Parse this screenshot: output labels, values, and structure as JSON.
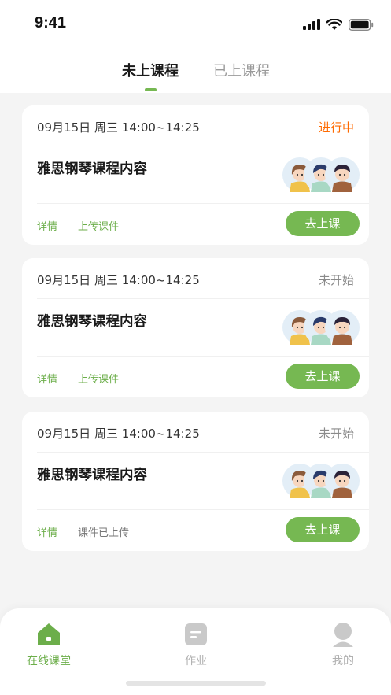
{
  "status_bar": {
    "time": "9:41"
  },
  "tabs": [
    {
      "label": "未上课程",
      "active": true
    },
    {
      "label": "已上课程",
      "active": false
    }
  ],
  "colors": {
    "accent": "#76b852",
    "live": "#ff6a00",
    "muted": "#8a8a8a"
  },
  "courses": [
    {
      "time": "09月15日 周三 14:00~14:25",
      "status": "进行中",
      "title": "雅思钢琴课程内容",
      "detail_label": "详情",
      "upload_label": "上传课件",
      "button_label": "去上课"
    },
    {
      "time": "09月15日 周三 14:00~14:25",
      "status": "未开始",
      "title": "雅思钢琴课程内容",
      "detail_label": "详情",
      "upload_label": "上传课件",
      "button_label": "去上课"
    },
    {
      "time": "09月15日 周三 14:00~14:25",
      "status": "未开始",
      "title": "雅思钢琴课程内容",
      "detail_label": "详情",
      "upload_label": "课件已上传",
      "button_label": "去上课"
    }
  ],
  "bottom_nav": [
    {
      "label": "在线课堂",
      "icon": "home-icon",
      "active": true
    },
    {
      "label": "作业",
      "icon": "homework-icon",
      "active": false
    },
    {
      "label": "我的",
      "icon": "profile-icon",
      "active": false
    }
  ]
}
